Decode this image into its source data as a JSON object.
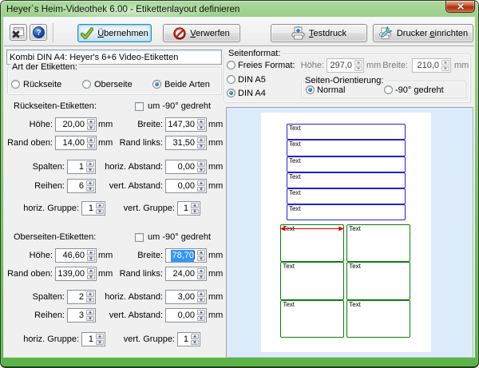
{
  "window": {
    "title": "Heyer`s Heim-Videothek 6.00 - Etikettenlayout definieren"
  },
  "toolbar": {
    "apply": {
      "prefix": "",
      "accel": "Ü",
      "suffix": "bernehmen"
    },
    "discard": {
      "prefix": "",
      "accel": "V",
      "suffix": "erwerfen"
    },
    "test_print": {
      "prefix": "",
      "accel": "T",
      "suffix": "estdruck"
    },
    "printer_setup": {
      "prefix": "Drucker ",
      "accel": "e",
      "suffix": "inrichten"
    },
    "help_glyph": "?"
  },
  "name_field": {
    "value": "Kombi DIN A4: Heyer's 6+6 Video-Etiketten"
  },
  "art_group": {
    "title": "Art der Etiketten:",
    "options": [
      {
        "label": "Rückseite",
        "selected": false
      },
      {
        "label": "Oberseite",
        "selected": false
      },
      {
        "label": "Beide Arten",
        "selected": true
      }
    ]
  },
  "back_section": {
    "title": "Rückseiten-Etiketten:",
    "rotate": {
      "label": "um -90° gedreht",
      "checked": false
    },
    "fields": [
      {
        "label": "Höhe:",
        "value": "20,00",
        "unit": "mm"
      },
      {
        "label": "Breite:",
        "value": "147,30",
        "unit": "mm"
      },
      {
        "label": "Rand oben:",
        "value": "14,00",
        "unit": "mm"
      },
      {
        "label": "Rand links:",
        "value": "31,50",
        "unit": "mm"
      },
      {
        "label": "Spalten:",
        "value": "1"
      },
      {
        "label": "horiz. Abstand:",
        "value": "0,00",
        "unit": "mm"
      },
      {
        "label": "Reihen:",
        "value": "6"
      },
      {
        "label": "vert. Abstand:",
        "value": "0,00",
        "unit": "mm"
      },
      {
        "label": "horiz. Gruppe:",
        "value": "1"
      },
      {
        "label": "vert. Gruppe:",
        "value": "1"
      }
    ]
  },
  "top_section": {
    "title": "Oberseiten-Etiketten:",
    "rotate": {
      "label": "um -90° gedreht",
      "checked": false
    },
    "fields": [
      {
        "label": "Höhe:",
        "value": "46,60",
        "unit": "mm"
      },
      {
        "label": "Breite:",
        "value": "78,70",
        "unit": "mm",
        "selected": true
      },
      {
        "label": "Rand oben:",
        "value": "139,00",
        "unit": "mm"
      },
      {
        "label": "Rand links:",
        "value": "24,00",
        "unit": "mm"
      },
      {
        "label": "Spalten:",
        "value": "2"
      },
      {
        "label": "horiz. Abstand:",
        "value": "3,00",
        "unit": "mm"
      },
      {
        "label": "Reihen:",
        "value": "3"
      },
      {
        "label": "vert. Abstand:",
        "value": "0,00",
        "unit": "mm"
      },
      {
        "label": "horiz. Gruppe:",
        "value": "1"
      },
      {
        "label": "vert. Gruppe:",
        "value": "1"
      }
    ]
  },
  "page_format": {
    "title": "Seitenformat:",
    "options": [
      {
        "label": "Freies Format:",
        "selected": false
      },
      {
        "label": "DIN A5",
        "selected": false
      },
      {
        "label": "DIN A4",
        "selected": true
      }
    ],
    "free_height": {
      "label": "Höhe:",
      "value": "297,0",
      "unit": "mm"
    },
    "free_width": {
      "label": "Breite:",
      "value": "210,0",
      "unit": "mm"
    },
    "orientation": {
      "title": "Seiten-Orientierung:",
      "options": [
        {
          "label": "Normal",
          "selected": true
        },
        {
          "label": "-90° gedreht",
          "selected": false
        }
      ]
    }
  },
  "preview": {
    "label_text": "Text",
    "page": {
      "width_mm": 210,
      "height_mm": 297
    },
    "back_labels": {
      "rows": 6,
      "cols": 1,
      "top_mm": 14,
      "left_mm": 31.5,
      "width_mm": 147.3,
      "height_mm": 20,
      "hgap_mm": 0,
      "vgap_mm": 0,
      "border_color": "#2222cc"
    },
    "top_labels": {
      "rows": 3,
      "cols": 2,
      "top_mm": 139,
      "left_mm": 24,
      "width_mm": 78.7,
      "height_mm": 46.6,
      "hgap_mm": 3,
      "vgap_mm": 0,
      "border_color": "#0b7d0b"
    },
    "arrow_color": "#e60000"
  },
  "colors": {
    "frame_green": "#6cbb58",
    "selection_blue": "#3297fd",
    "preview_bg": "#dcebfa",
    "client_bg": "#f0f0f0"
  }
}
